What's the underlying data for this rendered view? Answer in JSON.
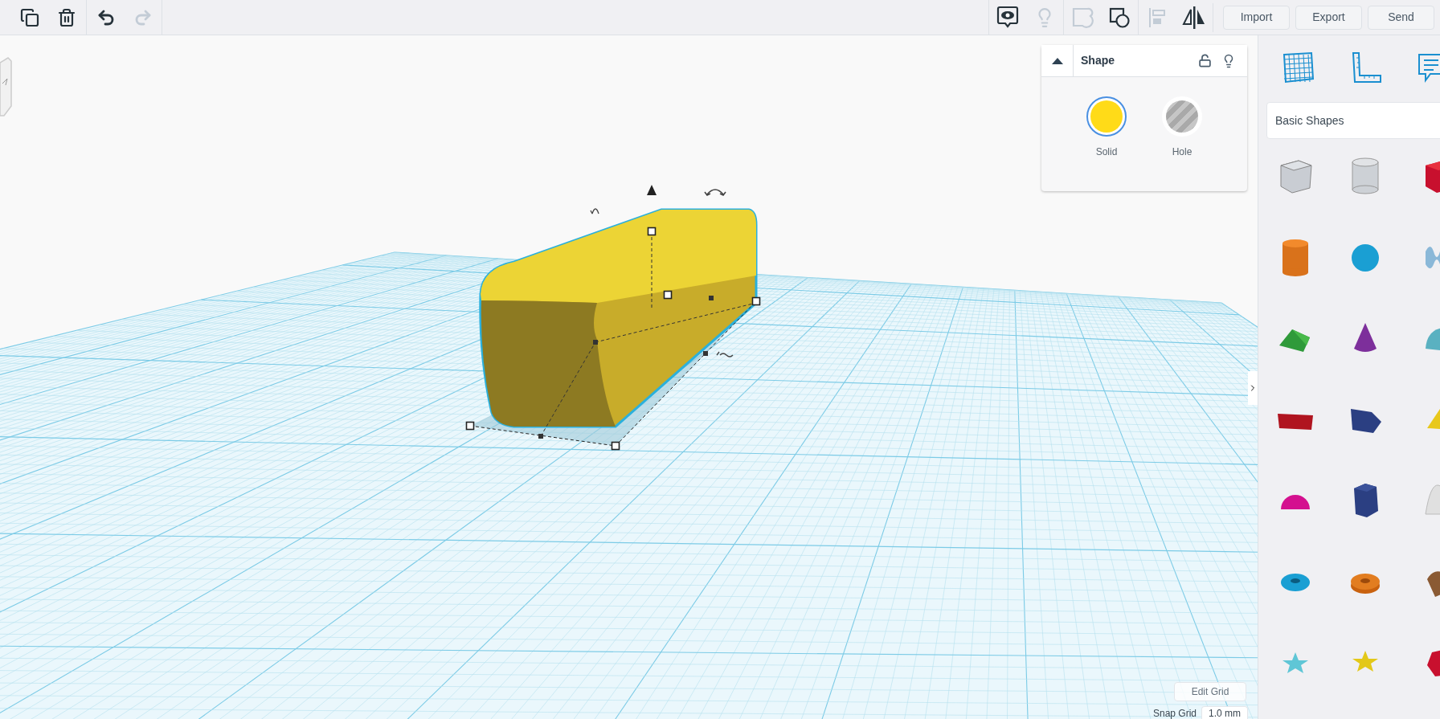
{
  "toolbar": {
    "left_tools": [
      {
        "kind": "copy",
        "disabled": false
      },
      {
        "kind": "delete",
        "disabled": false
      },
      {
        "kind": "undo",
        "disabled": false
      },
      {
        "kind": "redo",
        "disabled": true
      }
    ],
    "right_tools": [
      {
        "kind": "notes",
        "disabled": false
      },
      {
        "kind": "bulb",
        "disabled": true
      },
      {
        "kind": "group",
        "disabled": true
      },
      {
        "kind": "ungroup",
        "disabled": false
      },
      {
        "kind": "align",
        "disabled": true
      },
      {
        "kind": "mirror",
        "disabled": false
      }
    ],
    "buttons": [
      "Import",
      "Export",
      "Send"
    ]
  },
  "shape_panel": {
    "title": "Shape",
    "options": [
      {
        "label": "Solid",
        "kind": "solid",
        "selected": true
      },
      {
        "label": "Hole",
        "kind": "hole",
        "selected": false
      }
    ]
  },
  "library": {
    "category": "Basic Shapes"
  },
  "grid_controls": {
    "edit_grid": "Edit Grid",
    "snap_label": "Snap Grid",
    "snap_value": "1.0 mm"
  }
}
